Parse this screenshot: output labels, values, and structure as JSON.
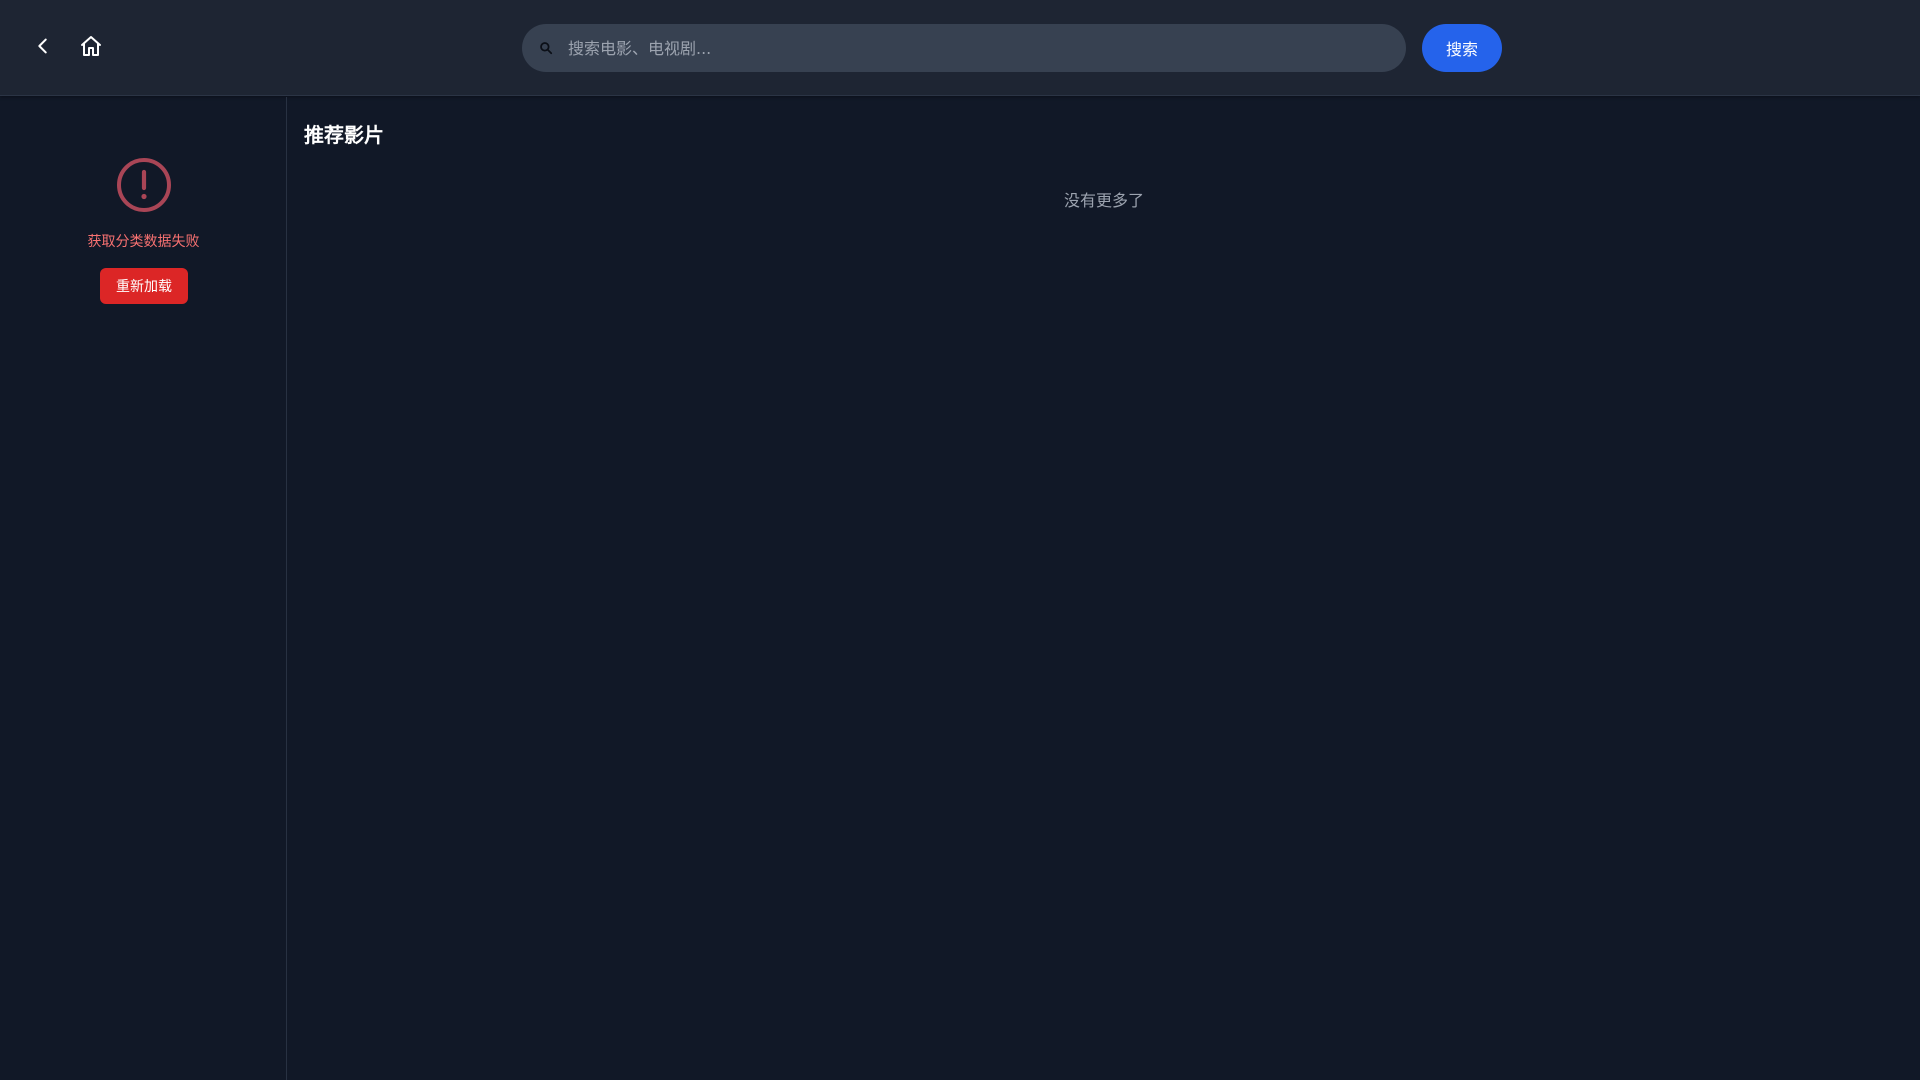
{
  "header": {
    "back_icon": "chevron-left-icon",
    "home_icon": "home-icon",
    "search": {
      "icon": "search-icon",
      "placeholder": "搜索电影、电视剧...",
      "value": ""
    },
    "search_button_label": "搜索"
  },
  "sidebar": {
    "error_icon": "exclamation-circle-icon",
    "error_message": "获取分类数据失败",
    "reload_button_label": "重新加载"
  },
  "main": {
    "section_title": "推荐影片",
    "no_more_text": "没有更多了"
  },
  "colors": {
    "background": "#111827",
    "header_background": "#1e2533",
    "search_background": "#374151",
    "primary_button": "#2563eb",
    "error_text": "#f87171",
    "error_icon": "#a94556",
    "reload_button": "#dc2626",
    "muted_text": "#9ca3af"
  }
}
